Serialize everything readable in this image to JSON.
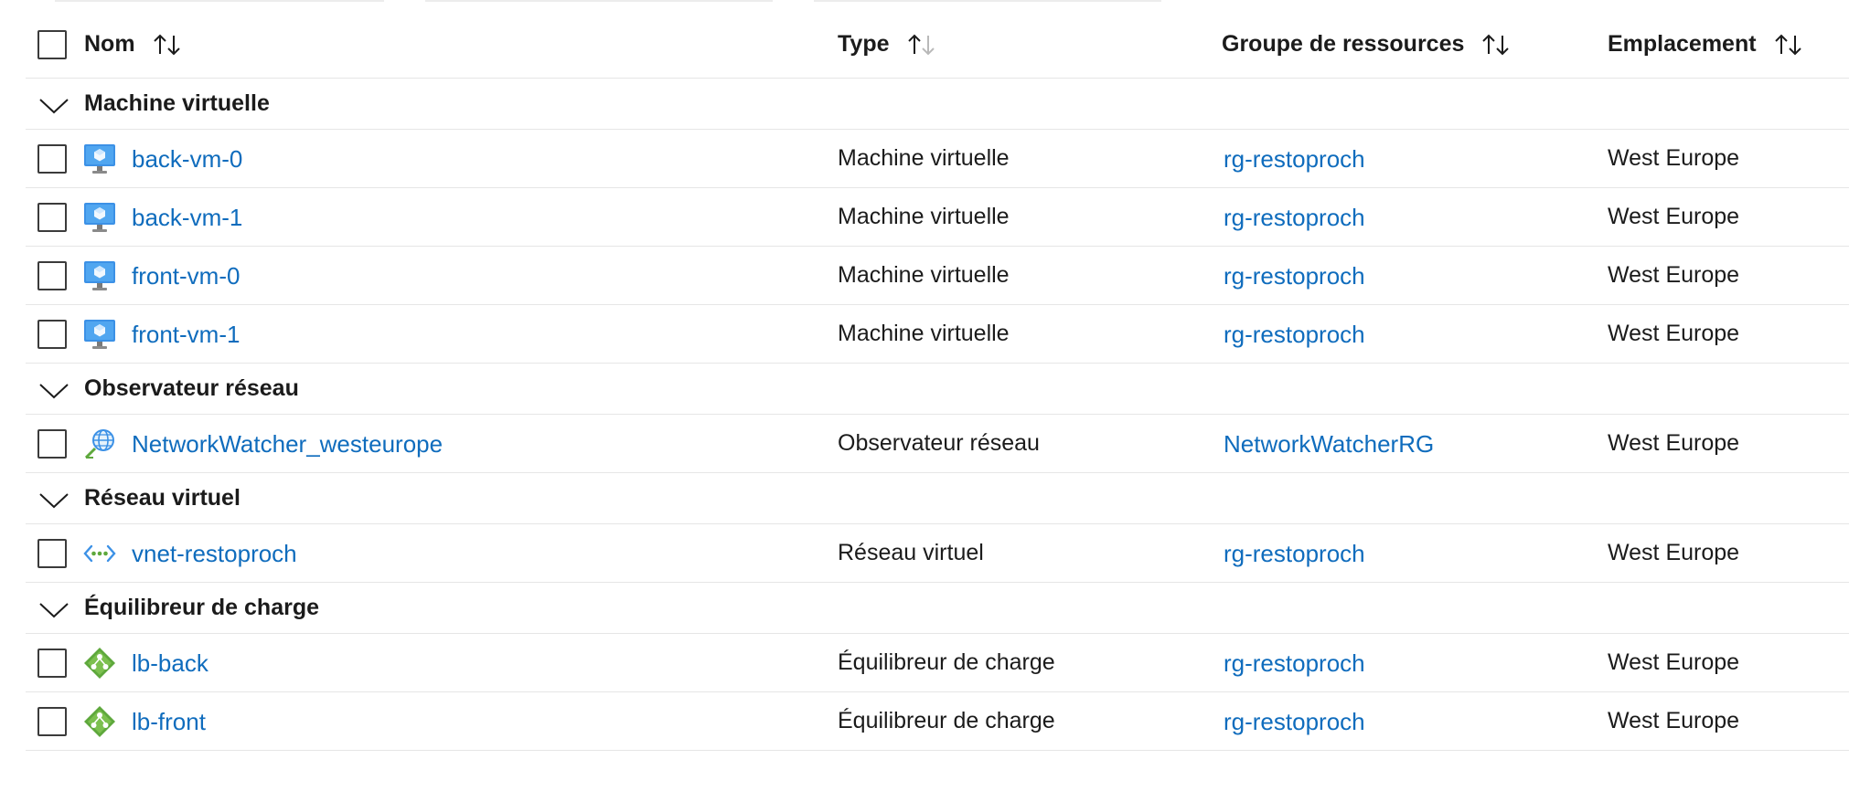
{
  "header": {
    "columns": [
      {
        "label": "Nom"
      },
      {
        "label": "Type"
      },
      {
        "label": "Groupe de ressources"
      },
      {
        "label": "Emplacement"
      }
    ]
  },
  "groups": [
    {
      "title": "Machine virtuelle",
      "rows": [
        {
          "name": "back-vm-0",
          "icon": "virtual-machine-icon",
          "type": "Machine virtuelle",
          "rg": "rg-restoproch",
          "location": "West Europe"
        },
        {
          "name": "back-vm-1",
          "icon": "virtual-machine-icon",
          "type": "Machine virtuelle",
          "rg": "rg-restoproch",
          "location": "West Europe"
        },
        {
          "name": "front-vm-0",
          "icon": "virtual-machine-icon",
          "type": "Machine virtuelle",
          "rg": "rg-restoproch",
          "location": "West Europe"
        },
        {
          "name": "front-vm-1",
          "icon": "virtual-machine-icon",
          "type": "Machine virtuelle",
          "rg": "rg-restoproch",
          "location": "West Europe"
        }
      ]
    },
    {
      "title": "Observateur réseau",
      "rows": [
        {
          "name": "NetworkWatcher_westeurope",
          "icon": "network-watcher-icon",
          "type": "Observateur réseau",
          "rg": "NetworkWatcherRG",
          "location": "West Europe"
        }
      ]
    },
    {
      "title": "Réseau virtuel",
      "rows": [
        {
          "name": "vnet-restoproch",
          "icon": "virtual-network-icon",
          "type": "Réseau virtuel",
          "rg": "rg-restoproch",
          "location": "West Europe"
        }
      ]
    },
    {
      "title": "Équilibreur de charge",
      "rows": [
        {
          "name": "lb-back",
          "icon": "load-balancer-icon",
          "type": "Équilibreur de charge",
          "rg": "rg-restoproch",
          "location": "West Europe"
        },
        {
          "name": "lb-front",
          "icon": "load-balancer-icon",
          "type": "Équilibreur de charge",
          "rg": "rg-restoproch",
          "location": "West Europe"
        }
      ]
    }
  ],
  "colors": {
    "link": "#0f6cbd",
    "text": "#1b1b1b",
    "divider": "#e6e6e6",
    "vm_icon": "#3c91e6",
    "lb_icon": "#5ea83c"
  }
}
